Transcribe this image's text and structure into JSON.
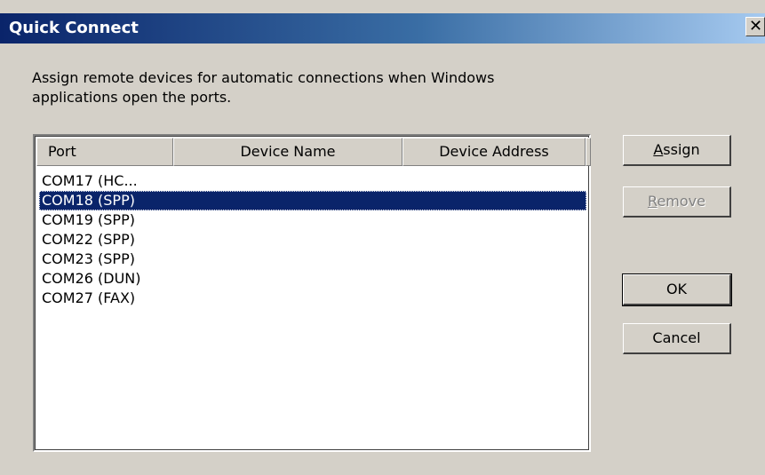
{
  "window": {
    "title": "Quick Connect",
    "close_glyph": "✕"
  },
  "description": {
    "line1": "Assign remote devices for automatic connections when Windows",
    "line2": "applications open the ports."
  },
  "list": {
    "columns": [
      "Port",
      "Device Name",
      "Device Address"
    ],
    "rows": [
      {
        "port": "COM17 (HC...",
        "device_name": "",
        "device_address": ""
      },
      {
        "port": "COM18 (SPP)",
        "device_name": "",
        "device_address": ""
      },
      {
        "port": "COM19 (SPP)",
        "device_name": "",
        "device_address": ""
      },
      {
        "port": "COM22 (SPP)",
        "device_name": "",
        "device_address": ""
      },
      {
        "port": "COM23 (SPP)",
        "device_name": "",
        "device_address": ""
      },
      {
        "port": "COM26 (DUN)",
        "device_name": "",
        "device_address": ""
      },
      {
        "port": "COM27 (FAX)",
        "device_name": "",
        "device_address": ""
      }
    ],
    "selected_row": 1
  },
  "buttons": {
    "assign": {
      "prefix": "",
      "accel": "A",
      "rest": "ssign"
    },
    "remove": {
      "prefix": "",
      "accel": "R",
      "rest": "emove"
    },
    "ok": "OK",
    "cancel": "Cancel"
  },
  "colors": {
    "titlebar_start": "#0a246a",
    "titlebar_end": "#a6caf0",
    "selection": "#0a246a",
    "dialog_face": "#d4d0c8"
  }
}
